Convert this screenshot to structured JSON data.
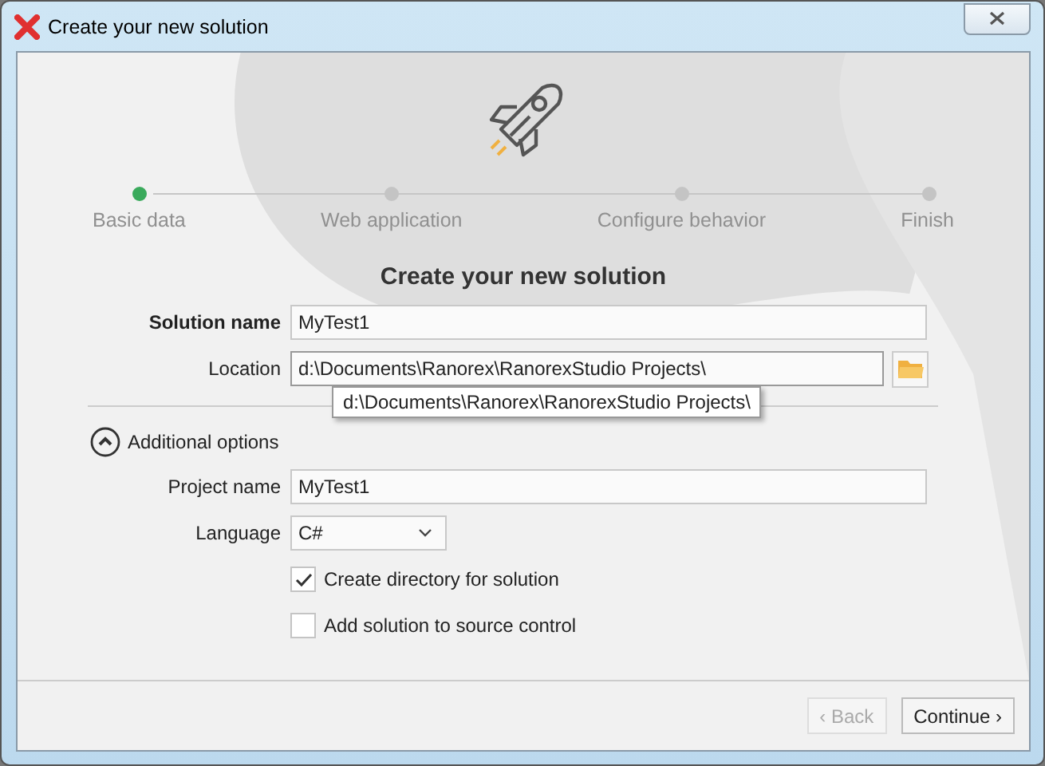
{
  "window": {
    "title": "Create your new solution"
  },
  "steps": [
    {
      "label": "Basic data",
      "selected": true
    },
    {
      "label": "Web application",
      "selected": false
    },
    {
      "label": "Configure behavior",
      "selected": false
    },
    {
      "label": "Finish",
      "selected": false
    }
  ],
  "heading": "Create your new solution",
  "fields": [
    {
      "kind": "text",
      "label": "Solution name",
      "required": true,
      "value": "MyTest1"
    },
    {
      "kind": "browse",
      "label": "Location",
      "required": false,
      "value": "d:\\Documents\\Ranorex\\RanorexStudio Projects\\"
    }
  ],
  "tooltip": "d:\\Documents\\Ranorex\\RanorexStudio Projects\\",
  "additional_options": {
    "label": "Additional options",
    "expanded": true
  },
  "options_fields": [
    {
      "kind": "text",
      "label": "Project name",
      "required": false,
      "value": "MyTest1"
    },
    {
      "kind": "dropdown",
      "label": "Language",
      "required": false,
      "value": "C#"
    }
  ],
  "checkboxes": [
    {
      "label": "Create directory for solution",
      "checked": true
    },
    {
      "label": "Add solution to source control",
      "checked": false
    }
  ],
  "buttons": [
    {
      "label": "‹ Back",
      "disabled": true
    },
    {
      "label": "Continue ›",
      "disabled": false
    }
  ]
}
